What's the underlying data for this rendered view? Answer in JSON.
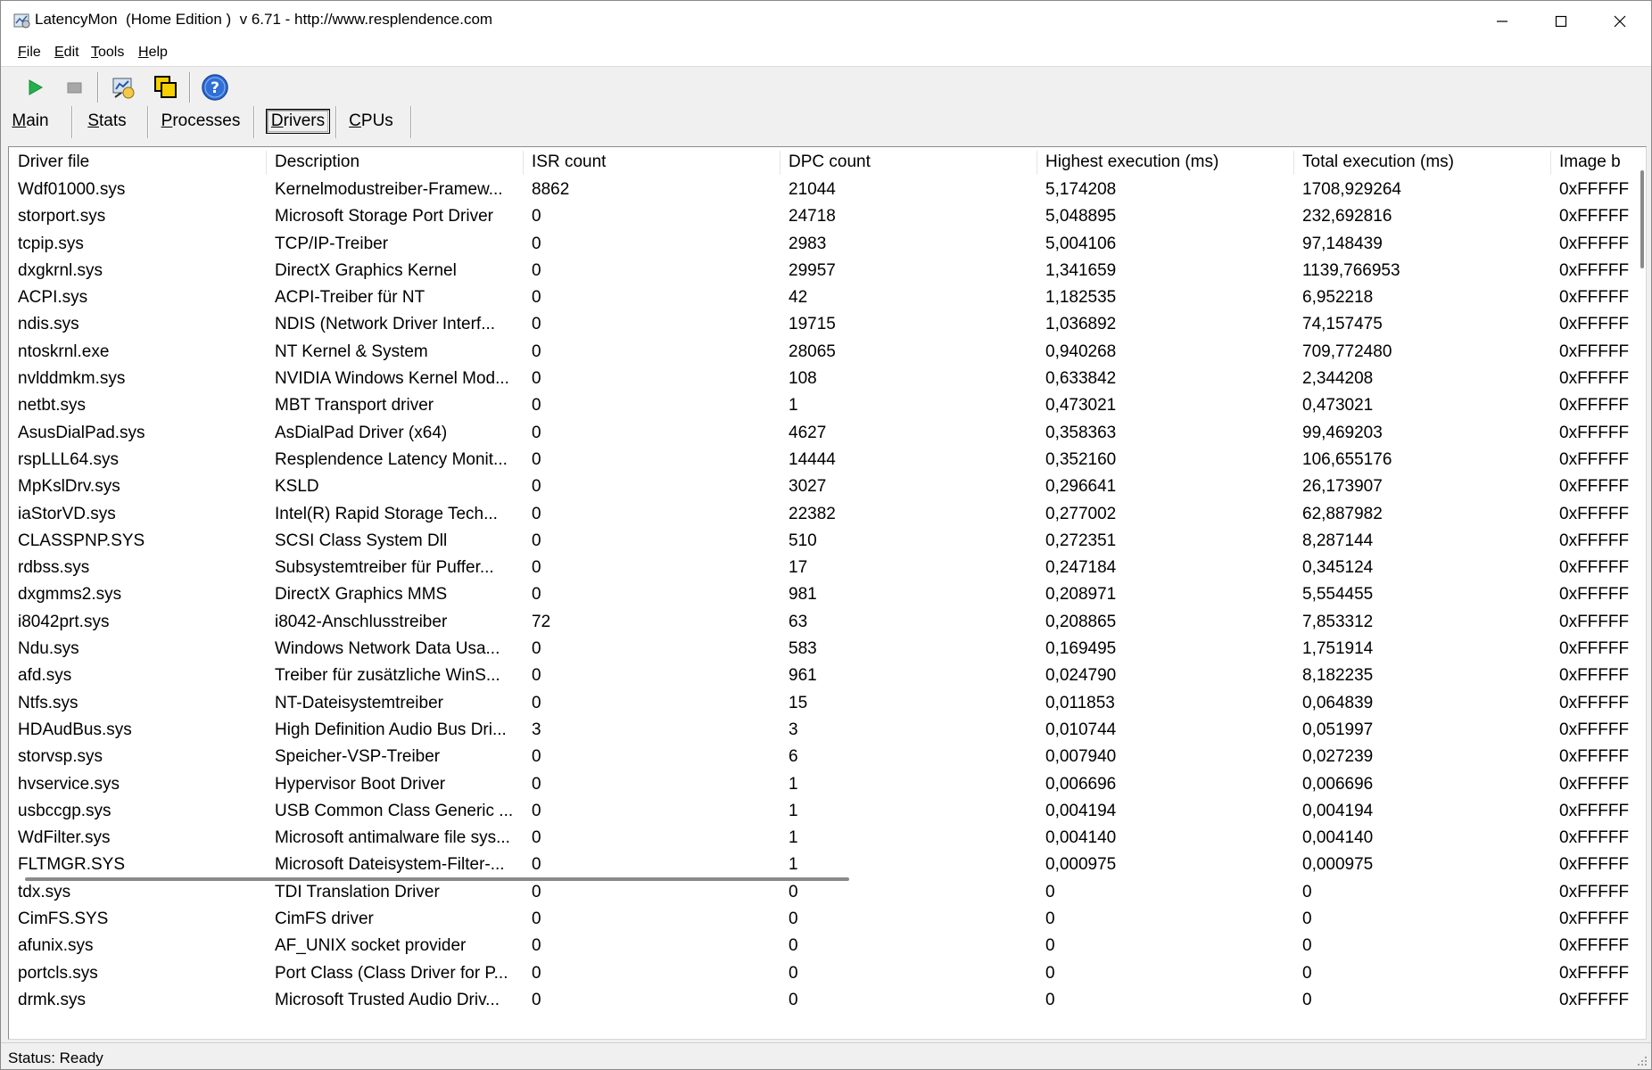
{
  "window": {
    "title": "LatencyMon  (Home Edition )  v 6.71 - http://www.resplendence.com"
  },
  "menu": [
    {
      "label": "File"
    },
    {
      "label": "Edit"
    },
    {
      "label": "Tools"
    },
    {
      "label": "Help"
    }
  ],
  "toolbar": {
    "icons": [
      "start-icon",
      "stop-icon",
      "report-icon",
      "windows-icon",
      "help-icon"
    ]
  },
  "tabs": [
    {
      "label": "Main",
      "active": false
    },
    {
      "label": "Stats",
      "active": false
    },
    {
      "label": "Processes",
      "active": false
    },
    {
      "label": "Drivers",
      "active": true
    },
    {
      "label": "CPUs",
      "active": false
    }
  ],
  "table": {
    "columns": [
      "Driver file",
      "Description",
      "ISR count",
      "DPC count",
      "Highest execution (ms)",
      "Total execution (ms)",
      "Image b"
    ],
    "rows": [
      [
        "Wdf01000.sys",
        "Kernelmodustreiber-Framew...",
        "8862",
        "21044",
        "5,174208",
        "1708,929264",
        "0xFFFFF"
      ],
      [
        "storport.sys",
        "Microsoft Storage Port Driver",
        "0",
        "24718",
        "5,048895",
        "232,692816",
        "0xFFFFF"
      ],
      [
        "tcpip.sys",
        "TCP/IP-Treiber",
        "0",
        "2983",
        "5,004106",
        "97,148439",
        "0xFFFFF"
      ],
      [
        "dxgkrnl.sys",
        "DirectX Graphics Kernel",
        "0",
        "29957",
        "1,341659",
        "1139,766953",
        "0xFFFFF"
      ],
      [
        "ACPI.sys",
        "ACPI-Treiber für NT",
        "0",
        "42",
        "1,182535",
        "6,952218",
        "0xFFFFF"
      ],
      [
        "ndis.sys",
        "NDIS (Network Driver Interf...",
        "0",
        "19715",
        "1,036892",
        "74,157475",
        "0xFFFFF"
      ],
      [
        "ntoskrnl.exe",
        "NT Kernel & System",
        "0",
        "28065",
        "0,940268",
        "709,772480",
        "0xFFFFF"
      ],
      [
        "nvlddmkm.sys",
        "NVIDIA Windows Kernel Mod...",
        "0",
        "108",
        "0,633842",
        "2,344208",
        "0xFFFFF"
      ],
      [
        "netbt.sys",
        "MBT Transport driver",
        "0",
        "1",
        "0,473021",
        "0,473021",
        "0xFFFFF"
      ],
      [
        "AsusDialPad.sys",
        "AsDialPad Driver (x64)",
        "0",
        "4627",
        "0,358363",
        "99,469203",
        "0xFFFFF"
      ],
      [
        "rspLLL64.sys",
        "Resplendence Latency Monit...",
        "0",
        "14444",
        "0,352160",
        "106,655176",
        "0xFFFFF"
      ],
      [
        "MpKslDrv.sys",
        "KSLD",
        "0",
        "3027",
        "0,296641",
        "26,173907",
        "0xFFFFF"
      ],
      [
        "iaStorVD.sys",
        "Intel(R) Rapid Storage Tech...",
        "0",
        "22382",
        "0,277002",
        "62,887982",
        "0xFFFFF"
      ],
      [
        "CLASSPNP.SYS",
        "SCSI Class System Dll",
        "0",
        "510",
        "0,272351",
        "8,287144",
        "0xFFFFF"
      ],
      [
        "rdbss.sys",
        "Subsystemtreiber für Puffer...",
        "0",
        "17",
        "0,247184",
        "0,345124",
        "0xFFFFF"
      ],
      [
        "dxgmms2.sys",
        "DirectX Graphics MMS",
        "0",
        "981",
        "0,208971",
        "5,554455",
        "0xFFFFF"
      ],
      [
        "i8042prt.sys",
        "i8042-Anschlusstreiber",
        "72",
        "63",
        "0,208865",
        "7,853312",
        "0xFFFFF"
      ],
      [
        "Ndu.sys",
        "Windows Network Data Usa...",
        "0",
        "583",
        "0,169495",
        "1,751914",
        "0xFFFFF"
      ],
      [
        "afd.sys",
        "Treiber für zusätzliche WinS...",
        "0",
        "961",
        "0,024790",
        "8,182235",
        "0xFFFFF"
      ],
      [
        "Ntfs.sys",
        "NT-Dateisystemtreiber",
        "0",
        "15",
        "0,011853",
        "0,064839",
        "0xFFFFF"
      ],
      [
        "HDAudBus.sys",
        "High Definition Audio Bus Dri...",
        "3",
        "3",
        "0,010744",
        "0,051997",
        "0xFFFFF"
      ],
      [
        "storvsp.sys",
        "Speicher-VSP-Treiber",
        "0",
        "6",
        "0,007940",
        "0,027239",
        "0xFFFFF"
      ],
      [
        "hvservice.sys",
        "Hypervisor Boot Driver",
        "0",
        "1",
        "0,006696",
        "0,006696",
        "0xFFFFF"
      ],
      [
        "usbccgp.sys",
        "USB Common Class Generic ...",
        "0",
        "1",
        "0,004194",
        "0,004194",
        "0xFFFFF"
      ],
      [
        "WdFilter.sys",
        "Microsoft antimalware file sys...",
        "0",
        "1",
        "0,004140",
        "0,004140",
        "0xFFFFF"
      ],
      [
        "FLTMGR.SYS",
        "Microsoft Dateisystem-Filter-...",
        "0",
        "1",
        "0,000975",
        "0,000975",
        "0xFFFFF"
      ],
      [
        "tdx.sys",
        "TDI Translation Driver",
        "0",
        "0",
        "0",
        "0",
        "0xFFFFF"
      ],
      [
        "CimFS.SYS",
        "CimFS driver",
        "0",
        "0",
        "0",
        "0",
        "0xFFFFF"
      ],
      [
        "afunix.sys",
        "AF_UNIX socket provider",
        "0",
        "0",
        "0",
        "0",
        "0xFFFFF"
      ],
      [
        "portcls.sys",
        "Port Class (Class Driver for P...",
        "0",
        "0",
        "0",
        "0",
        "0xFFFFF"
      ],
      [
        "drmk.sys",
        "Microsoft Trusted Audio Driv...",
        "0",
        "0",
        "0",
        "0",
        "0xFFFFF"
      ]
    ]
  },
  "status": {
    "text": "Status: Ready"
  }
}
